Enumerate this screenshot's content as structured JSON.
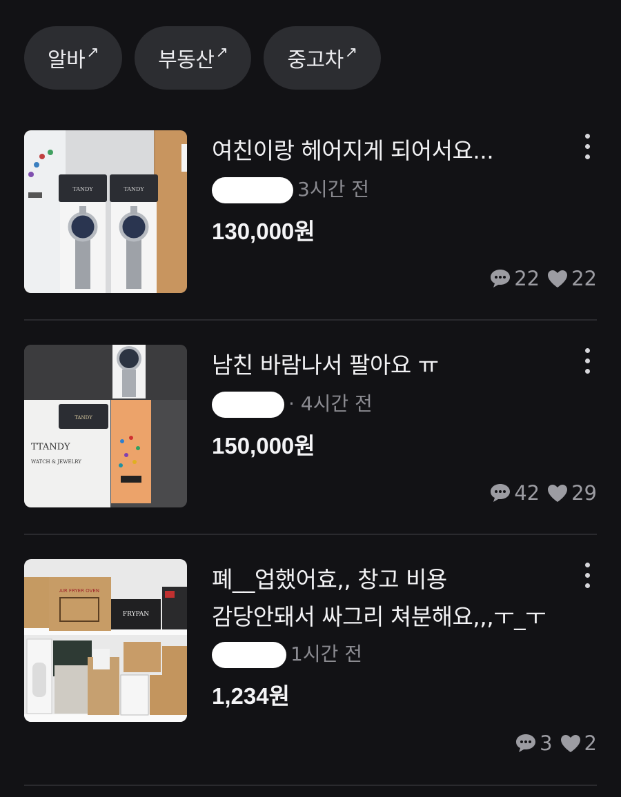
{
  "chips": [
    {
      "label": "알바",
      "arrow": "↗"
    },
    {
      "label": "부동산",
      "arrow": "↗"
    },
    {
      "label": "중고차",
      "arrow": "↗"
    }
  ],
  "items": [
    {
      "title_lines": [
        "여친이랑 헤어지게 되어서요..."
      ],
      "time": "3시간 전",
      "price": "130,000원",
      "comments": "22",
      "likes": "22",
      "thumb_desc": "two TANDY watches in boxes"
    },
    {
      "title_lines": [
        "남친 바람나서 팔아요 ㅠ"
      ],
      "time": "· 4시간 전",
      "price": "150,000원",
      "comments": "42",
      "likes": "29",
      "thumb_desc": "TANDY watch with bag",
      "bag_brand": "TTANDY",
      "bag_sub": "WATCH & JEWELRY"
    },
    {
      "title_lines": [
        "폐__업했어효,, 창고 비용",
        "감당안돼서 싸그리 쳐분해요,,,ㅜ_ㅜ"
      ],
      "time": "1시간 전",
      "price": "1,234원",
      "comments": "3",
      "likes": "2",
      "thumb_desc": "shelves of boxed appliances",
      "box_label_1": "AIR FRYER OVEN",
      "box_label_2": "FRYPAN"
    }
  ],
  "colors": {
    "background": "#121215",
    "chip": "#2c2d31",
    "muted": "#8b8b91"
  },
  "icons": {
    "comment": "chat-bubble-icon",
    "like": "heart-icon",
    "menu": "more-vertical-icon"
  }
}
